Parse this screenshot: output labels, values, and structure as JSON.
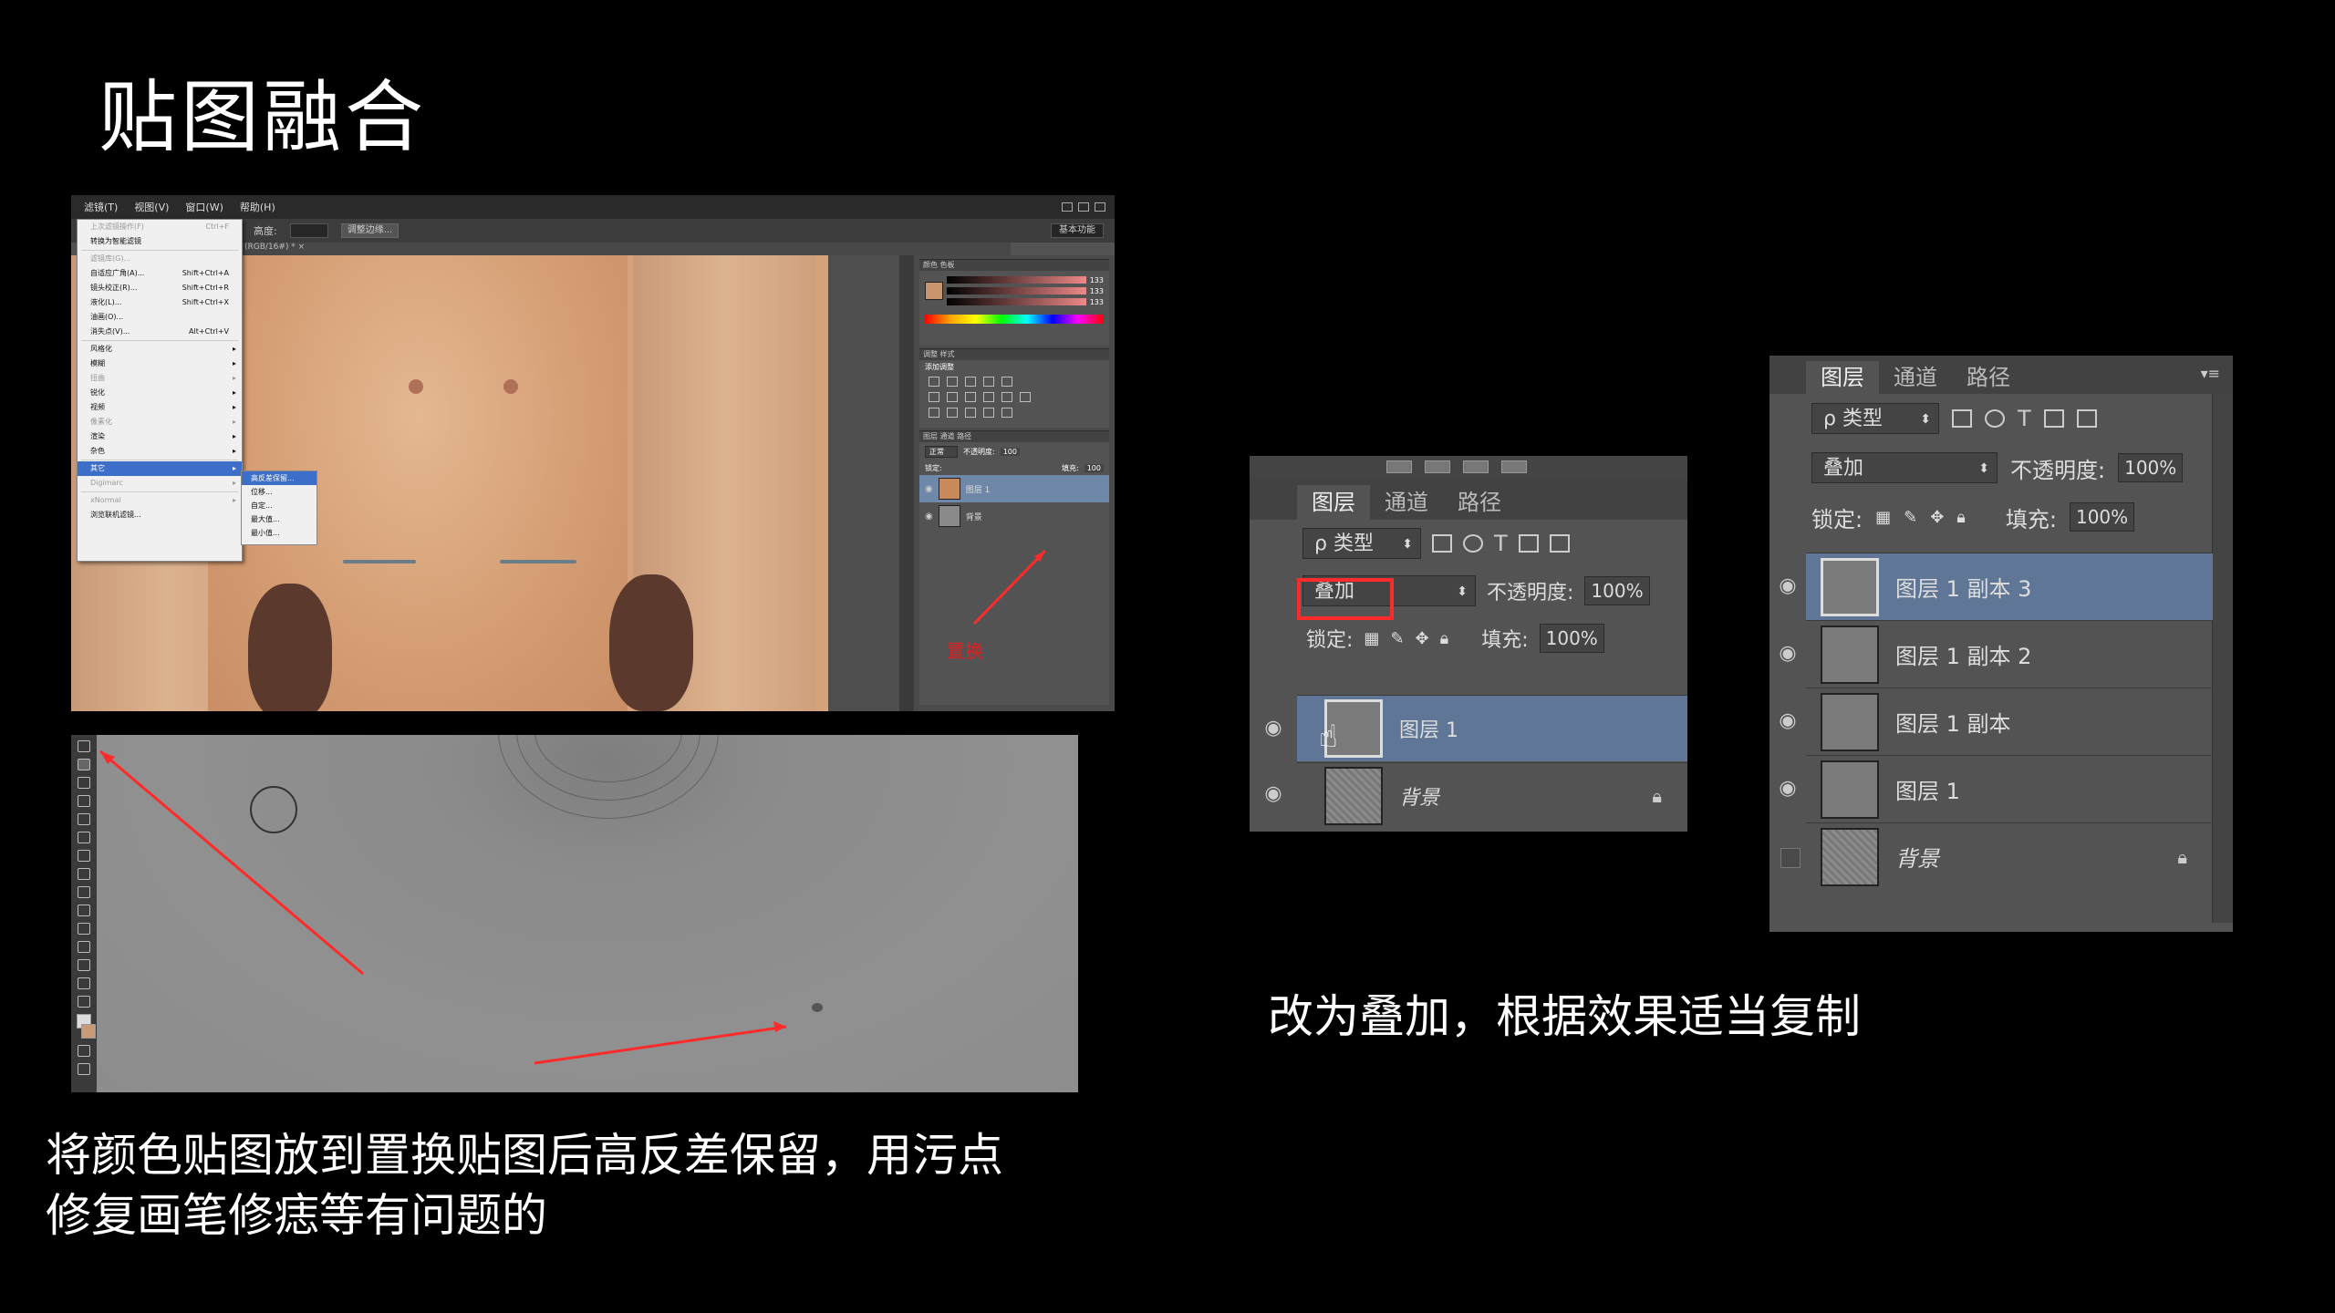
{
  "slide": {
    "title": "贴图融合",
    "caption_left_line1": "将颜色贴图放到置换贴图后高反差保留，用污点",
    "caption_left_line2": "修复画笔修痣等有问题的",
    "caption_right": "改为叠加，根据效果适当复制"
  },
  "shot1": {
    "menubar": [
      "滤镜(T)",
      "视图(V)",
      "窗口(W)",
      "帮助(H)"
    ],
    "options_label": "高度:",
    "options_button": "调整边缘...",
    "workspace": "基本功能",
    "doc_tab": "(RGB/16#) * ×",
    "menu_items": [
      {
        "label": "上次滤镜操作(F)",
        "shortcut": "Ctrl+F",
        "disabled": true
      },
      {
        "label": "转换为智能滤镜",
        "shortcut": ""
      },
      {
        "label": "滤镜库(G)...",
        "shortcut": "",
        "disabled": true
      },
      {
        "label": "自适应广角(A)...",
        "shortcut": "Shift+Ctrl+A"
      },
      {
        "label": "镜头校正(R)...",
        "shortcut": "Shift+Ctrl+R"
      },
      {
        "label": "液化(L)...",
        "shortcut": "Shift+Ctrl+X"
      },
      {
        "label": "油画(O)...",
        "shortcut": ""
      },
      {
        "label": "消失点(V)...",
        "shortcut": "Alt+Ctrl+V"
      },
      {
        "label": "风格化",
        "shortcut": "",
        "submenu": true
      },
      {
        "label": "模糊",
        "shortcut": "",
        "submenu": true
      },
      {
        "label": "扭曲",
        "shortcut": "",
        "submenu": true,
        "disabled": true
      },
      {
        "label": "锐化",
        "shortcut": "",
        "submenu": true
      },
      {
        "label": "视频",
        "shortcut": "",
        "submenu": true
      },
      {
        "label": "像素化",
        "shortcut": "",
        "submenu": true,
        "disabled": true
      },
      {
        "label": "渲染",
        "shortcut": "",
        "submenu": true
      },
      {
        "label": "杂色",
        "shortcut": "",
        "submenu": true
      },
      {
        "label": "其它",
        "shortcut": "",
        "submenu": true,
        "highlighted": true
      },
      {
        "label": "Digimarc",
        "shortcut": "",
        "submenu": true,
        "disabled": true
      },
      {
        "label": "xNormal",
        "shortcut": "",
        "submenu": true,
        "disabled": true
      },
      {
        "label": "浏览联机滤镜...",
        "shortcut": ""
      }
    ],
    "submenu_items": [
      {
        "label": "高反差保留...",
        "highlighted": true
      },
      {
        "label": "位移..."
      },
      {
        "label": "自定..."
      },
      {
        "label": "最大值..."
      },
      {
        "label": "最小值..."
      }
    ],
    "color_panel_tabs": "颜色   色板",
    "rgb_values": [
      "133",
      "133",
      "133"
    ],
    "adjust_tabs": "调整   样式",
    "adjust_title": "添加调整",
    "layers_tabs": "图层   通道   路径",
    "blend_mode": "正常",
    "opacity_label": "不透明度:",
    "opacity_value": "100",
    "lock_label": "锁定:",
    "fill_label": "填充:",
    "fill_value": "100",
    "layers": [
      {
        "name": "图层 1",
        "selected": true
      },
      {
        "name": "背景",
        "selected": false
      }
    ],
    "annotation": "置换"
  },
  "shot3": {
    "tabs": [
      "图层",
      "通道",
      "路径"
    ],
    "kind": "ρ 类型",
    "blend_mode": "叠加",
    "opacity_label": "不透明度:",
    "opacity_value": "100%",
    "lock_label": "锁定:",
    "fill_label": "填充:",
    "fill_value": "100%",
    "layers": [
      {
        "name": "图层 1",
        "selected": true
      },
      {
        "name": "背景",
        "selected": false
      }
    ]
  },
  "shot4": {
    "tabs": [
      "图层",
      "通道",
      "路径"
    ],
    "kind": "ρ 类型",
    "blend_mode": "叠加",
    "opacity_label": "不透明度:",
    "opacity_value": "100%",
    "lock_label": "锁定:",
    "fill_label": "填充:",
    "fill_value": "100%",
    "layers": [
      {
        "name": "图层 1 副本 3",
        "selected": true
      },
      {
        "name": "图层 1 副本 2",
        "selected": false
      },
      {
        "name": "图层 1 副本",
        "selected": false
      },
      {
        "name": "图层 1",
        "selected": false
      },
      {
        "name": "背景",
        "selected": false
      }
    ]
  },
  "colors": {
    "selection": "#5f7696",
    "annotation_red": "#ff2a2a",
    "panel_bg": "#535353"
  }
}
